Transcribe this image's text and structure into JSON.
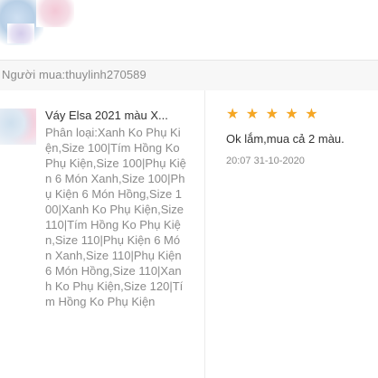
{
  "review": {
    "buyer_label": "Người mua:thuylinh270589",
    "product_title": "Váy Elsa 2021 màu X...",
    "variant_text": "Phân loại:Xanh Ko Phụ Kiện,Size 100|Tím Hồng Ko Phụ Kiện,Size 100|Phụ Kiện 6 Món Xanh,Size 100|Phụ Kiện 6 Món Hồng,Size 100|Xanh Ko Phụ Kiện,Size 110|Tím Hồng Ko Phụ Kiện,Size 110|Phụ Kiện 6 Món Xanh,Size 110|Phụ Kiện 6 Món Hồng,Size 110|Xanh Ko Phụ Kiện,Size 120|Tím Hồng Ko Phụ Kiện",
    "rating": 5,
    "star_glyph": "★",
    "star_color": "#f5a623",
    "comment": "Ok lắm,mua cả 2 màu.",
    "timestamp": "20:07 31-10-2020"
  }
}
